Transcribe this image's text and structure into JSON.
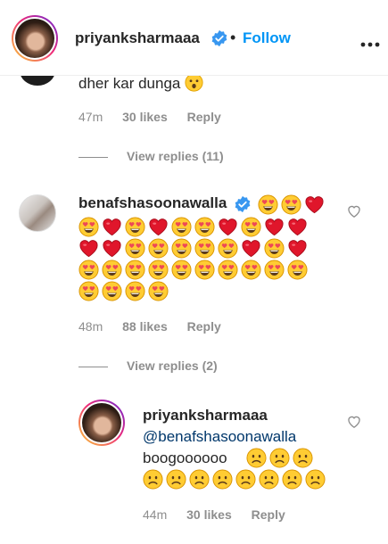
{
  "header": {
    "username": "priyanksharmaaa",
    "separator": "•",
    "follow_label": "Follow"
  },
  "prev_comment": {
    "text_fragment": "dher kar dunga",
    "emoji": "face-with-open-mouth",
    "time": "47m",
    "likes": "30 likes",
    "reply_label": "Reply",
    "view_replies": "View replies (11)"
  },
  "comment": {
    "username": "benafshasoonawalla",
    "emoji_rows": [
      [
        "heart-eyes",
        "heart-eyes",
        "red-heart"
      ],
      [
        "heart-eyes",
        "red-heart",
        "heart-eyes",
        "red-heart",
        "heart-eyes",
        "heart-eyes",
        "red-heart",
        "heart-eyes",
        "red-heart",
        "red-heart"
      ],
      [
        "red-heart",
        "red-heart",
        "heart-eyes",
        "heart-eyes",
        "heart-eyes",
        "heart-eyes",
        "heart-eyes",
        "red-heart",
        "heart-eyes",
        "red-heart"
      ],
      [
        "heart-eyes",
        "heart-eyes",
        "heart-eyes",
        "heart-eyes",
        "heart-eyes",
        "heart-eyes",
        "heart-eyes",
        "heart-eyes",
        "heart-eyes",
        "heart-eyes"
      ],
      [
        "heart-eyes",
        "heart-eyes",
        "heart-eyes",
        "heart-eyes"
      ]
    ],
    "time": "48m",
    "likes": "88 likes",
    "reply_label": "Reply",
    "view_replies": "View replies (2)"
  },
  "reply": {
    "username": "priyanksharmaaa",
    "mention": "@benafshasoonawalla",
    "text": "boogoooooo",
    "emoji_rows": [
      [
        "frowning-face",
        "frowning-face",
        "frowning-face"
      ],
      [
        "frowning-face",
        "frowning-face",
        "frowning-face",
        "frowning-face",
        "frowning-face",
        "frowning-face",
        "frowning-face",
        "frowning-face"
      ]
    ],
    "time": "44m",
    "likes": "30 likes",
    "reply_label": "Reply"
  },
  "colors": {
    "text": "#262626",
    "muted": "#8e8e8e",
    "link": "#0095f6",
    "mention": "#00376b",
    "verified": "#3897f0",
    "heart": "#ed4956",
    "emoji_face": "#ffcc33"
  }
}
